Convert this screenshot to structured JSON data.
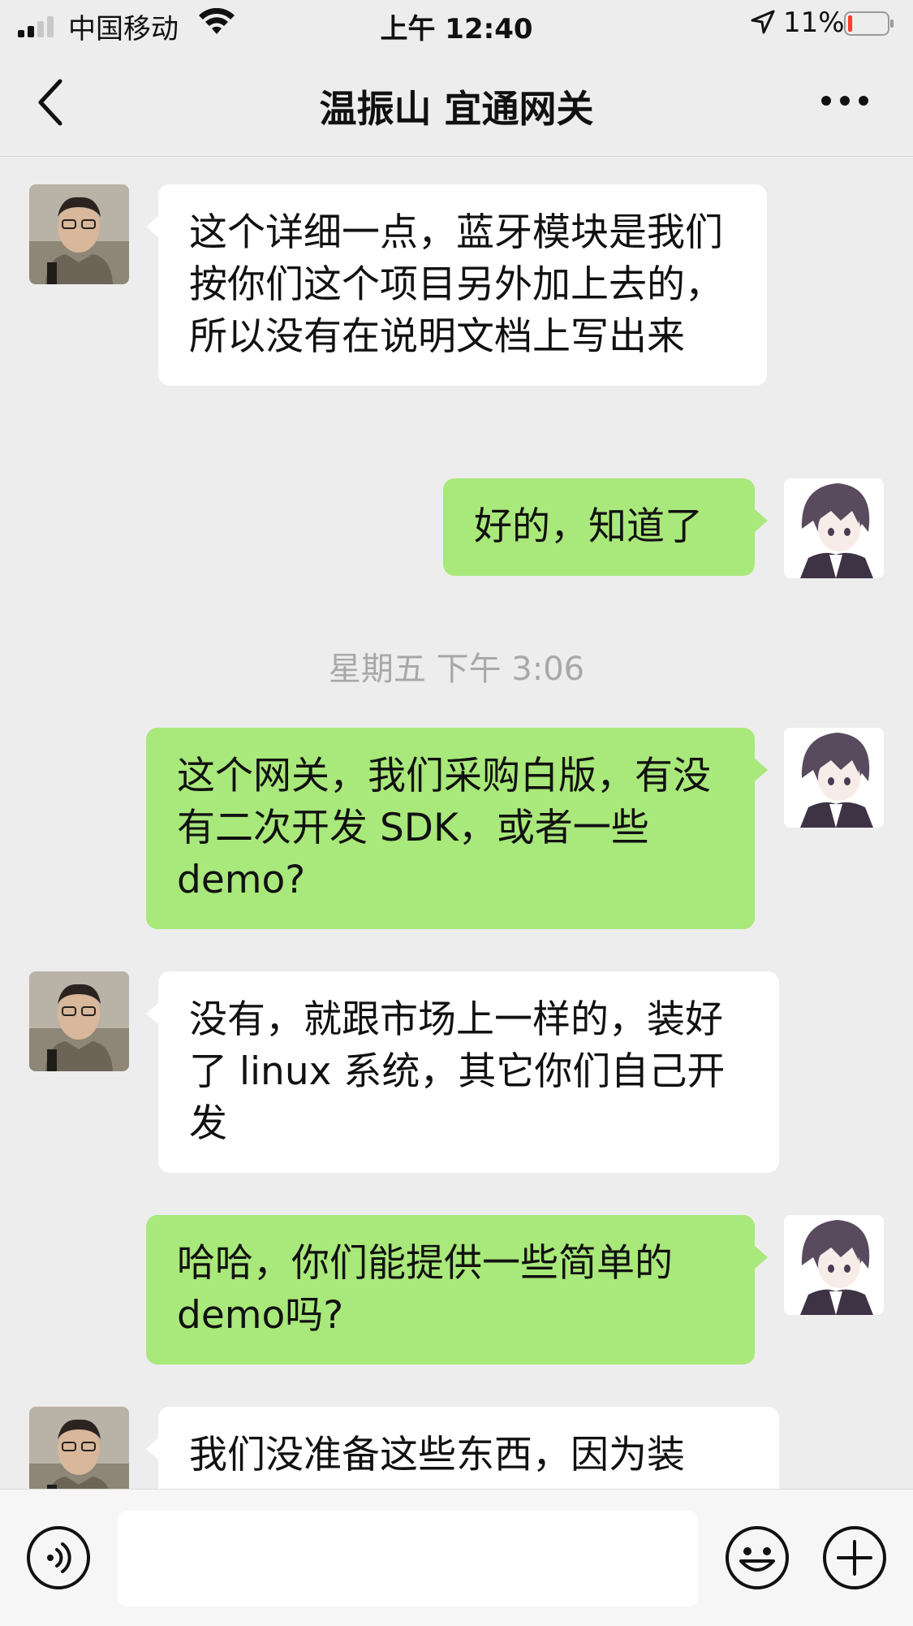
{
  "status_bar": {
    "carrier": "中国移动",
    "time": "上午 12:40",
    "battery_percent": "11%",
    "battery_level": 0.11,
    "signal_bars": 2
  },
  "header": {
    "title": "温振山 宜通网关",
    "back_icon": "chevron-left-icon",
    "more_icon": "more-dots-icon"
  },
  "messages": [
    {
      "from": "other",
      "text": "这个详细一点，蓝牙模块是我们按你们这个项目另外加上去的，所以没有在说明文档上写出来"
    },
    {
      "from": "me",
      "text": "好的，知道了"
    },
    {
      "timestamp": "星期五 下午 3:06"
    },
    {
      "from": "me",
      "text": "这个网关，我们采购白版，有没有二次开发 SDK，或者一些demo?"
    },
    {
      "from": "other",
      "text": "没有，就跟市场上一样的，装好了 linux 系统，其它你们自己开发"
    },
    {
      "from": "me",
      "text": "哈哈，你们能提供一些简单的demo吗?"
    },
    {
      "from": "other",
      "text": "我们没准备这些东西，因为装"
    }
  ],
  "input_bar": {
    "voice_icon": "voice-icon",
    "input_value": "",
    "emoji_icon": "emoji-icon",
    "plus_icon": "plus-icon"
  },
  "colors": {
    "background": "#ededed",
    "bubble_me": "#a9e87a",
    "bubble_other": "#ffffff",
    "timestamp": "#a8a8a8",
    "battery_low": "#ff3b30"
  }
}
